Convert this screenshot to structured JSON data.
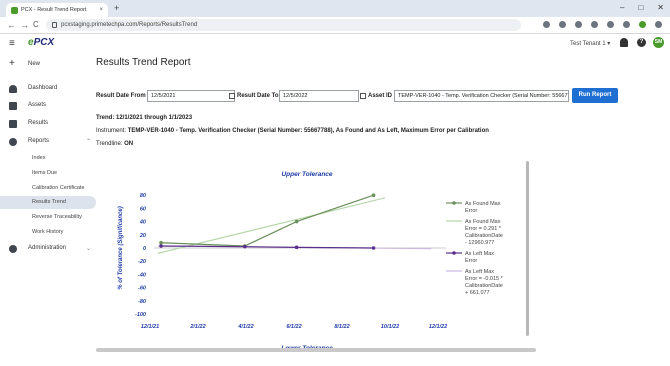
{
  "browser": {
    "tab_title": "PCX - Result Trend Report",
    "tab_close": "×",
    "new_tab": "+",
    "url": "pcxstaging.primetechpa.com/Reports/ResultsTrend",
    "win_min": "–",
    "win_max": "□",
    "win_close": "✕",
    "back": "←",
    "forward": "→",
    "reload": "C"
  },
  "header": {
    "logo_prefix": "e",
    "logo_text": "PCX",
    "tenant": "Test Tenant 1 ▾",
    "help": "?",
    "avatar": "SM"
  },
  "sidebar": {
    "hamburger": "≡",
    "items": [
      {
        "label": "New"
      },
      {
        "label": "Dashboard"
      },
      {
        "label": "Assets"
      },
      {
        "label": "Results"
      },
      {
        "label": "Reports"
      },
      {
        "label": "Administration"
      }
    ],
    "reports_sub": [
      "Index",
      "Items Due",
      "Calibration Certificate",
      "Results Trend",
      "Reverse Traceability",
      "Work History"
    ],
    "chevron": "⌃",
    "chevron_down": "⌄"
  },
  "main": {
    "title": "Results Trend Report",
    "filters": {
      "date_from_label": "Result Date From",
      "date_from": "12/5/2021",
      "date_to_label": "Result Date To",
      "date_to": "12/5/2022",
      "asset_label": "Asset ID",
      "asset_value": "TEMP-VER-1040 - Temp. Verification Checker (Serial Number: 55667788)",
      "run_label": "Run Report"
    },
    "trend_line": "Trend: 12/1/2021 through 1/1/2023",
    "instrument_label": "Instrument:",
    "instrument_value": "TEMP-VER-1040 - Temp. Verification Checker (Serial Number: 55667788), As Found and As Left, Maximum Error per Calibration",
    "trendline_label": "Trendline:",
    "trendline_value": "ON"
  },
  "chart_data": {
    "type": "line",
    "title_top": "Upper Tolerance",
    "title_bottom": "Lower Tolerance",
    "ylabel": "% of Tolerance (Significance)",
    "ylim": [
      -100,
      100
    ],
    "y_ticks": [
      -100,
      -80,
      -60,
      -40,
      -20,
      0,
      20,
      40,
      60,
      80
    ],
    "x_ticks": [
      "12/1/21",
      "2/1/22",
      "4/1/22",
      "6/1/22",
      "8/1/22",
      "10/1/22",
      "12/1/22"
    ],
    "x_domain": [
      "2021-12-01",
      "2022-12-01"
    ],
    "series": [
      {
        "name": "As Found Max Error",
        "color": "#6a8f5a",
        "points": [
          {
            "x": "2021-12-05",
            "y": 8
          },
          {
            "x": "2022-03-25",
            "y": 3
          },
          {
            "x": "2022-06-01",
            "y": 40
          },
          {
            "x": "2022-09-10",
            "y": 80
          }
        ]
      },
      {
        "name": "As Left Max Error",
        "color": "#5a2f8a",
        "points": [
          {
            "x": "2021-12-05",
            "y": 3
          },
          {
            "x": "2022-03-25",
            "y": 2
          },
          {
            "x": "2022-06-01",
            "y": 1
          },
          {
            "x": "2022-09-10",
            "y": 0
          }
        ]
      }
    ],
    "trendlines": [
      {
        "name": "As Found Max Error = 0.291 * CalibrationDate - 12960.977",
        "color": "#b5d6a7",
        "from": {
          "x": "2021-12-01",
          "y": -8
        },
        "to": {
          "x": "2022-09-25",
          "y": 76
        }
      },
      {
        "name": "As Left Max Error = -0.015 * CalibrationDate + 661.077",
        "color": "#cdb8e3",
        "from": {
          "x": "2021-12-01",
          "y": 3
        },
        "to": {
          "x": "2022-11-25",
          "y": -1
        }
      }
    ],
    "legend": [
      {
        "lines": [
          "As Found Max",
          "Error"
        ],
        "color": "#6a8f5a",
        "marker": true
      },
      {
        "lines": [
          "As Found Max",
          "Error = 0.291 *",
          "CalibrationDate",
          "- 12960.977"
        ],
        "color": "#b5d6a7",
        "marker": false
      },
      {
        "lines": [
          "As Left Max",
          "Error"
        ],
        "color": "#5a2f8a",
        "marker": true
      },
      {
        "lines": [
          "As Left Max",
          "Error = -0.015 *",
          "CalibrationDate",
          "+ 661.077"
        ],
        "color": "#cdb8e3",
        "marker": false
      }
    ],
    "legend_position": "right"
  }
}
